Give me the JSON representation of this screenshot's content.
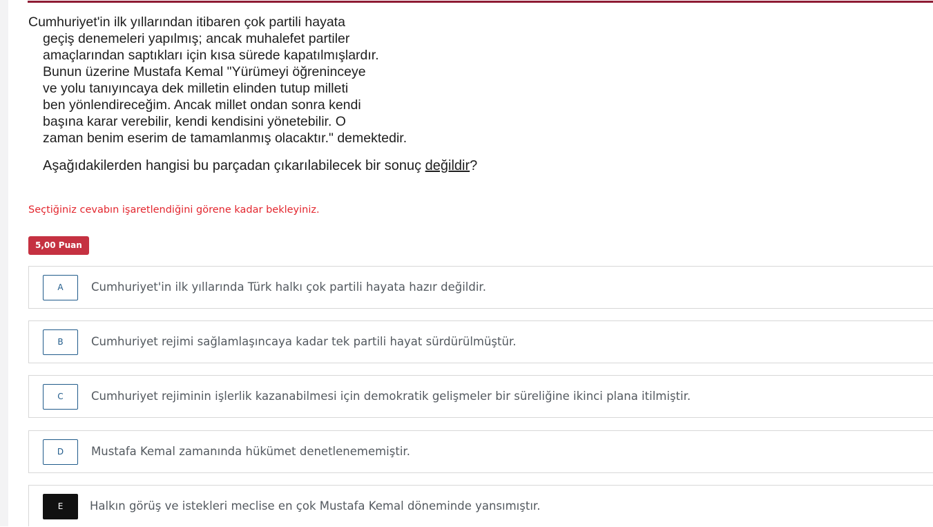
{
  "colors": {
    "top_rule": "#8e1b33",
    "warning": "#e3262e",
    "badge": "#c53141",
    "option_letter": "#1f5a8a",
    "selected_letter_bg": "#111111"
  },
  "question": {
    "lines": [
      "Cumhuriyet'in ilk yıllarından itibaren çok partili hayata",
      "geçiş denemeleri yapılmış; ancak muhalefet partiler",
      "amaçlarından saptıkları için kısa sürede kapatılmışlardır.",
      "Bunun üzerine Mustafa Kemal \"Yürümeyi öğreninceye",
      "ve yolu tanıyıncaya dek milletin elinden tutup milleti",
      "ben yönlendireceğim. Ancak millet ondan sonra kendi",
      "başına karar verebilir, kendi kendisini yönetebilir. O",
      "zaman benim eserim de tamamlanmış olacaktır.\" demektedir."
    ],
    "prompt_before": "Aşağıdakilerden hangisi bu parçadan çıkarılabilecek bir sonuç ",
    "prompt_emphasis": "değildir",
    "prompt_after": "?"
  },
  "warning": "Seçtiğiniz cevabın işaretlendiğini görene kadar bekleyiniz.",
  "points": "5,00 Puan",
  "options": [
    {
      "letter": "A",
      "text": "Cumhuriyet'in ilk yıllarında Türk halkı çok partili hayata hazır değildir.",
      "selected": false
    },
    {
      "letter": "B",
      "text": "Cumhuriyet rejimi sağlamlaşıncaya kadar tek partili hayat sürdürülmüştür.",
      "selected": false
    },
    {
      "letter": "C",
      "text": "Cumhuriyet rejiminin işlerlik kazanabilmesi için demokratik gelişmeler bir süreliğine ikinci plana itilmiştir.",
      "selected": false
    },
    {
      "letter": "D",
      "text": "Mustafa Kemal zamanında hükümet denetlenememiştir.",
      "selected": false
    },
    {
      "letter": "E",
      "text": "Halkın görüş ve istekleri meclise en çok Mustafa Kemal döneminde yansımıştır.",
      "selected": true
    }
  ]
}
